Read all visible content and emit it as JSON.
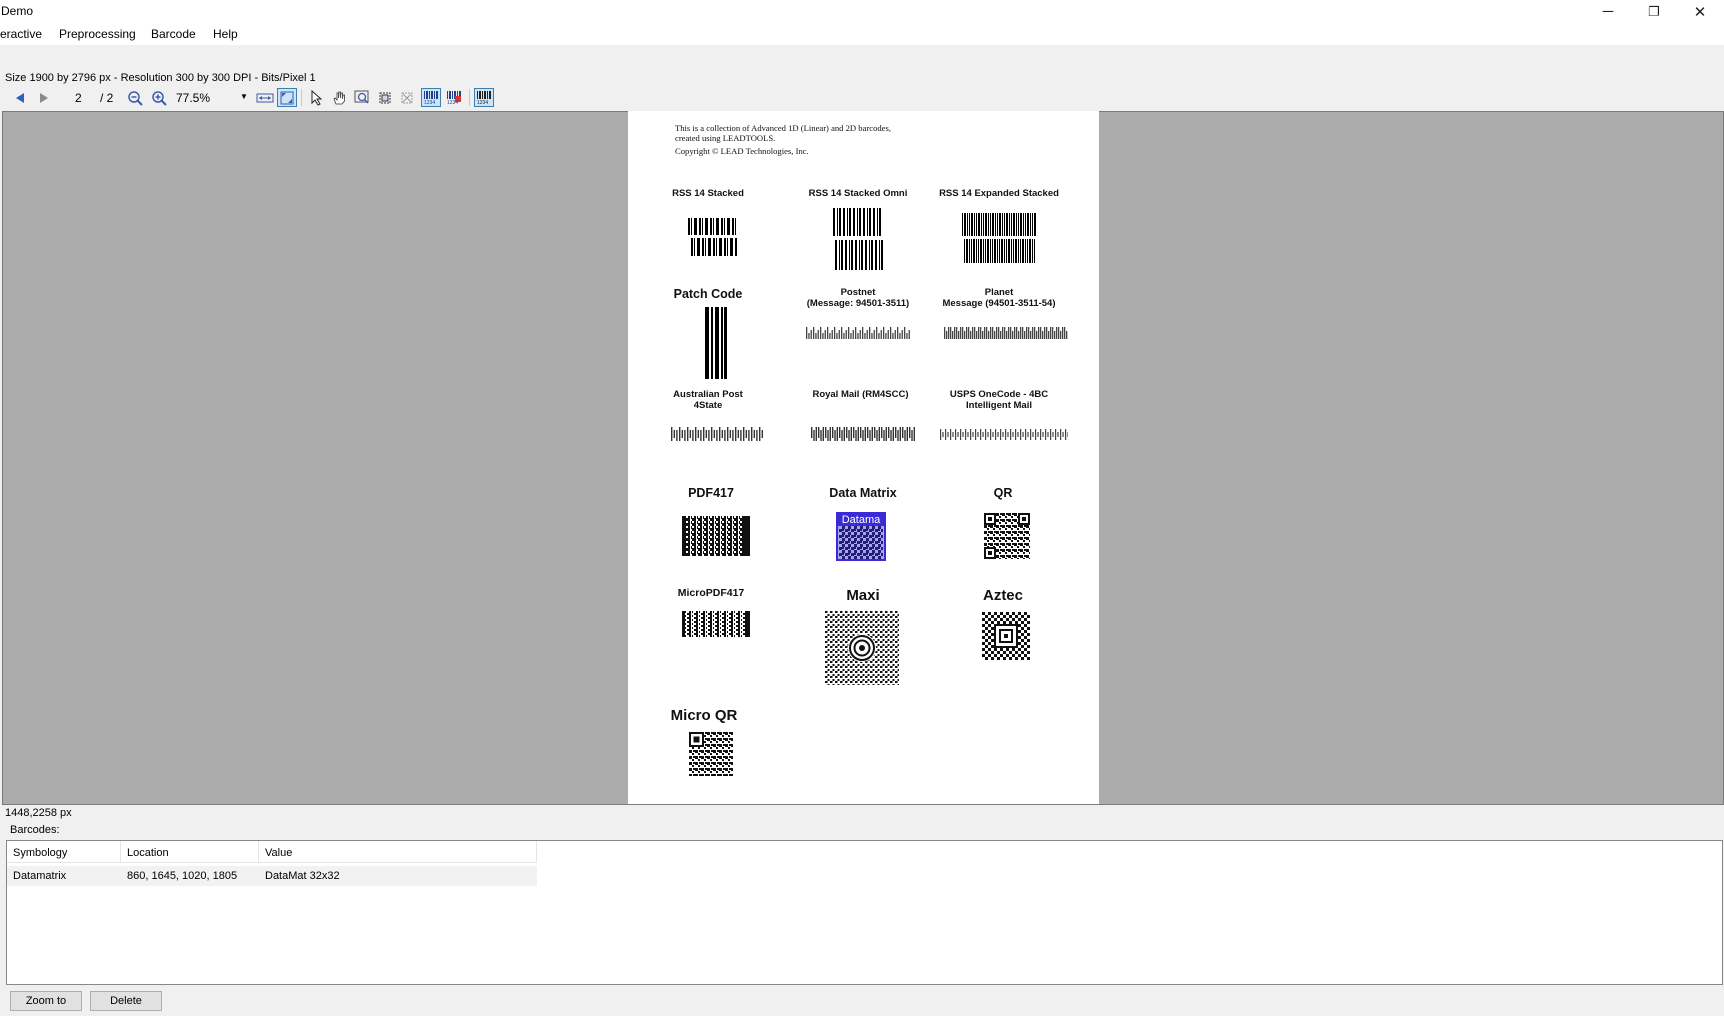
{
  "window": {
    "title": "Demo",
    "minimize_glyph": "─",
    "restore_glyph": "❐",
    "close_glyph": "✕"
  },
  "menu": {
    "items": [
      "eractive",
      "Preprocessing",
      "Barcode",
      "Help"
    ]
  },
  "image_info": "Size 1900 by 2796 px - Resolution 300 by 300 DPI - Bits/Pixel 1",
  "toolbar": {
    "page_number": "2",
    "page_total": "/ 2",
    "zoom": "77.5%"
  },
  "document": {
    "note_line1": "This is a collection of Advanced 1D (Linear) and 2D barcodes,",
    "note_line2": "created using LEADTOOLS.",
    "copyright": "Copyright © LEAD Technologies, Inc.",
    "labels": {
      "rss14_stacked": "RSS 14 Stacked",
      "rss14_stacked_omni": "RSS 14 Stacked Omni",
      "rss14_expanded_stacked": "RSS 14 Expanded Stacked",
      "patch_code": "Patch Code",
      "postnet_1": "Postnet",
      "postnet_2": "(Message: 94501-3511)",
      "planet_1": "Planet",
      "planet_2": "Message (94501-3511-54)",
      "australian_1": "Australian Post",
      "australian_2": "4State",
      "royal_mail": "Royal Mail (RM4SCC)",
      "usps_1": "USPS OneCode - 4BC",
      "usps_2": "Intelligent Mail",
      "pdf417": "PDF417",
      "data_matrix": "Data Matrix",
      "qr": "QR",
      "micropdf417": "MicroPDF417",
      "maxi": "Maxi",
      "aztec": "Aztec",
      "micro_qr": "Micro QR"
    },
    "highlight_tag": "Datama"
  },
  "status": {
    "cursor": "1448,2258 px"
  },
  "barcodes_panel": {
    "caption": "Barcodes:",
    "columns": [
      "Symbology",
      "Location",
      "Value"
    ],
    "rows": [
      {
        "symbology": "Datamatrix",
        "location": "860, 1645, 1020, 1805",
        "value": "DataMat 32x32"
      }
    ]
  },
  "buttons": {
    "zoom_to": "Zoom to",
    "delete": "Delete"
  },
  "icons": [
    "prev-page-icon",
    "next-page-icon",
    "zoom-out-icon",
    "zoom-in-icon",
    "fit-width-icon",
    "fit-page-icon",
    "select-pointer-icon",
    "pan-hand-icon",
    "magnify-glass-icon",
    "region-icon",
    "clear-region-icon",
    "barcode-read-icon",
    "barcode-read-all-icon",
    "barcode-write-icon"
  ]
}
